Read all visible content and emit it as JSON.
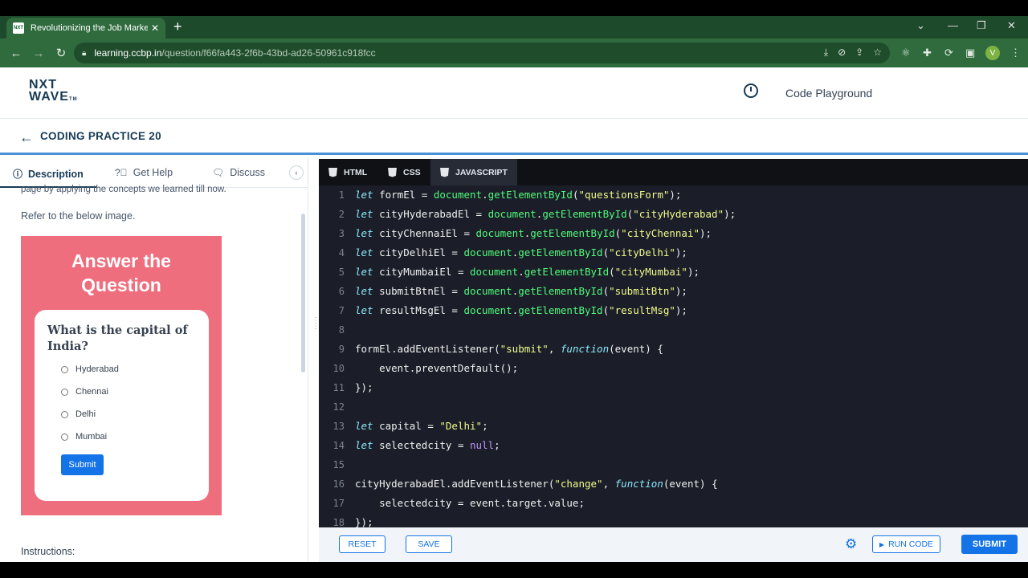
{
  "browser": {
    "tab_title": "Revolutionizing the Job Market |",
    "favicon_text": "NXT",
    "new_tab": "+",
    "url_domain": "learning.ccbp.in",
    "url_path": "/question/f66fa443-2f6b-43bd-ad26-50961c918fcc",
    "profile_initial": "V"
  },
  "header": {
    "logo_top": "NXT",
    "logo_bottom": "WAVE",
    "logo_tm": "TM",
    "playground_label": "Code Playground"
  },
  "breadcrumb": {
    "title": "CODING PRACTICE 20"
  },
  "left_panel": {
    "tabs": [
      {
        "label": "Description"
      },
      {
        "label": "Get Help"
      },
      {
        "label": "Discuss"
      }
    ],
    "partial_text": "page by applying the concepts we learned till now.",
    "refer_text": "Refer to the below image.",
    "instructions_label": "Instructions:",
    "preview": {
      "title_line1": "Answer the",
      "title_line2": "Question",
      "question": "What is the capital of India?",
      "options": [
        "Hyderabad",
        "Chennai",
        "Delhi",
        "Mumbai"
      ],
      "submit": "Submit"
    }
  },
  "editor": {
    "tabs": [
      {
        "label": "HTML"
      },
      {
        "label": "CSS"
      },
      {
        "label": "JAVASCRIPT"
      }
    ],
    "lines": [
      {
        "n": "1",
        "t": [
          [
            "kw",
            "let"
          ],
          [
            "",
            "formEl = "
          ],
          [
            "fn",
            "document"
          ],
          [
            "",
            "."
          ],
          [
            "fn",
            "getElementById"
          ],
          [
            "",
            "("
          ],
          [
            "str",
            "\"questionsForm\""
          ],
          [
            "",
            ");"
          ]
        ]
      },
      {
        "n": "2",
        "t": [
          [
            "kw",
            "let"
          ],
          [
            "",
            "cityHyderabadEl = "
          ],
          [
            "fn",
            "document"
          ],
          [
            "",
            "."
          ],
          [
            "fn",
            "getElementById"
          ],
          [
            "",
            "("
          ],
          [
            "str",
            "\"cityHyderabad\""
          ],
          [
            "",
            ");"
          ]
        ]
      },
      {
        "n": "3",
        "t": [
          [
            "kw",
            "let"
          ],
          [
            "",
            "cityChennaiEl = "
          ],
          [
            "fn",
            "document"
          ],
          [
            "",
            "."
          ],
          [
            "fn",
            "getElementById"
          ],
          [
            "",
            "("
          ],
          [
            "str",
            "\"cityChennai\""
          ],
          [
            "",
            ");"
          ]
        ]
      },
      {
        "n": "4",
        "t": [
          [
            "kw",
            "let"
          ],
          [
            "",
            "cityDelhiEl = "
          ],
          [
            "fn",
            "document"
          ],
          [
            "",
            "."
          ],
          [
            "fn",
            "getElementById"
          ],
          [
            "",
            "("
          ],
          [
            "str",
            "\"cityDelhi\""
          ],
          [
            "",
            ");"
          ]
        ]
      },
      {
        "n": "5",
        "t": [
          [
            "kw",
            "let"
          ],
          [
            "",
            "cityMumbaiEl = "
          ],
          [
            "fn",
            "document"
          ],
          [
            "",
            "."
          ],
          [
            "fn",
            "getElementById"
          ],
          [
            "",
            "("
          ],
          [
            "str",
            "\"cityMumbai\""
          ],
          [
            "",
            ");"
          ]
        ]
      },
      {
        "n": "6",
        "t": [
          [
            "kw",
            "let"
          ],
          [
            "",
            "submitBtnEl = "
          ],
          [
            "fn",
            "document"
          ],
          [
            "",
            "."
          ],
          [
            "fn",
            "getElementById"
          ],
          [
            "",
            "("
          ],
          [
            "str",
            "\"submitBtn\""
          ],
          [
            "",
            ");"
          ]
        ]
      },
      {
        "n": "7",
        "t": [
          [
            "kw",
            "let"
          ],
          [
            "",
            "resultMsgEl = "
          ],
          [
            "fn",
            "document"
          ],
          [
            "",
            "."
          ],
          [
            "fn",
            "getElementById"
          ],
          [
            "",
            "("
          ],
          [
            "str",
            "\"resultMsg\""
          ],
          [
            "",
            ");"
          ]
        ]
      },
      {
        "n": "8",
        "t": []
      },
      {
        "n": "9",
        "t": [
          [
            "",
            "formEl.addEventListener("
          ],
          [
            "str",
            "\"submit\""
          ],
          [
            "",
            ", "
          ],
          [
            "kw",
            "function"
          ],
          [
            "",
            "(event) {"
          ]
        ]
      },
      {
        "n": "10",
        "t": [
          [
            "",
            "    event.preventDefault();"
          ]
        ]
      },
      {
        "n": "11",
        "t": [
          [
            "",
            "});"
          ]
        ]
      },
      {
        "n": "12",
        "t": []
      },
      {
        "n": "13",
        "t": [
          [
            "kw",
            "let"
          ],
          [
            "",
            "capital = "
          ],
          [
            "str",
            "\"Delhi\""
          ],
          [
            "",
            ";"
          ]
        ]
      },
      {
        "n": "14",
        "t": [
          [
            "kw",
            "let"
          ],
          [
            "",
            "selectedcity = "
          ],
          [
            "nl",
            "null"
          ],
          [
            "",
            ";"
          ]
        ]
      },
      {
        "n": "15",
        "t": []
      },
      {
        "n": "16",
        "t": [
          [
            "",
            "cityHyderabadEl.addEventListener("
          ],
          [
            "str",
            "\"change\""
          ],
          [
            "",
            ", "
          ],
          [
            "kw",
            "function"
          ],
          [
            "",
            "(event) {"
          ]
        ]
      },
      {
        "n": "17",
        "t": [
          [
            "",
            "    selectedcity = event.target.value;"
          ]
        ]
      },
      {
        "n": "18",
        "t": [
          [
            "",
            "});"
          ]
        ]
      }
    ]
  },
  "footer": {
    "reset": "RESET",
    "save": "SAVE",
    "run": "RUN CODE",
    "submit": "SUBMIT"
  }
}
